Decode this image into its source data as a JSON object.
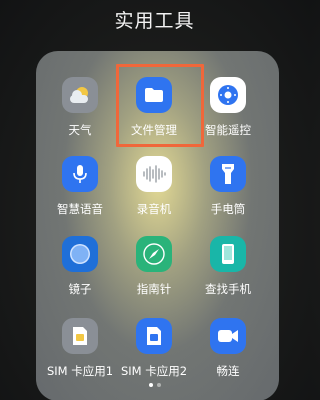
{
  "folder": {
    "title": "实用工具"
  },
  "apps": [
    {
      "label": "天气",
      "icon": "weather-icon",
      "color": "#8a8f96"
    },
    {
      "label": "文件管理",
      "icon": "folder-icon",
      "color": "#2f74f0"
    },
    {
      "label": "智能遥控",
      "icon": "remote-control-icon",
      "color": "#ffffff"
    },
    {
      "label": "智慧语音",
      "icon": "microphone-icon",
      "color": "#2f74f0"
    },
    {
      "label": "录音机",
      "icon": "sound-wave-icon",
      "color": "#ffffff"
    },
    {
      "label": "手电筒",
      "icon": "flashlight-icon",
      "color": "#2f74f0"
    },
    {
      "label": "镜子",
      "icon": "mirror-icon",
      "color": "#1f6fd8"
    },
    {
      "label": "指南针",
      "icon": "compass-icon",
      "color": "#2ab37a"
    },
    {
      "label": "查找手机",
      "icon": "find-phone-icon",
      "color": "#19b6a8"
    },
    {
      "label": "SIM 卡应用1",
      "icon": "sim-card-icon",
      "color": "#8a8f96"
    },
    {
      "label": "SIM 卡应用2",
      "icon": "sim-card-icon",
      "color": "#2f74f0"
    },
    {
      "label": "畅连",
      "icon": "video-call-icon",
      "color": "#2f74f0"
    }
  ],
  "highlight_color": "#f0673a",
  "pagination": {
    "current": 1,
    "total": 2
  }
}
